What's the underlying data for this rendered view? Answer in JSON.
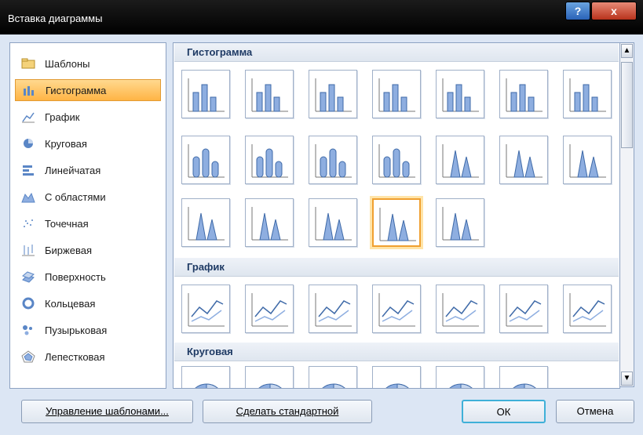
{
  "window": {
    "title": "Вставка диаграммы",
    "help_label": "?",
    "close_label": "x"
  },
  "categories": [
    {
      "label": "Шаблоны",
      "icon": "folder-icon"
    },
    {
      "label": "Гистограмма",
      "icon": "column-chart-icon",
      "selected": true
    },
    {
      "label": "График",
      "icon": "line-chart-icon"
    },
    {
      "label": "Круговая",
      "icon": "pie-chart-icon"
    },
    {
      "label": "Линейчатая",
      "icon": "bar-chart-icon"
    },
    {
      "label": "С областями",
      "icon": "area-chart-icon"
    },
    {
      "label": "Точечная",
      "icon": "scatter-chart-icon"
    },
    {
      "label": "Биржевая",
      "icon": "stock-chart-icon"
    },
    {
      "label": "Поверхность",
      "icon": "surface-chart-icon"
    },
    {
      "label": "Кольцевая",
      "icon": "doughnut-chart-icon"
    },
    {
      "label": "Пузырьковая",
      "icon": "bubble-chart-icon"
    },
    {
      "label": "Лепестковая",
      "icon": "radar-chart-icon"
    }
  ],
  "sections": {
    "histogram": "Гистограмма",
    "line": "График",
    "pie": "Круговая"
  },
  "buttons": {
    "manage_templates": "Управление шаблонами...",
    "set_default": "Сделать стандартной",
    "ok": "ОК",
    "cancel": "Отмена"
  },
  "colors": {
    "accent": "#ffb445",
    "section_text": "#1e3a64",
    "chart_blue": "#5a86c6"
  }
}
